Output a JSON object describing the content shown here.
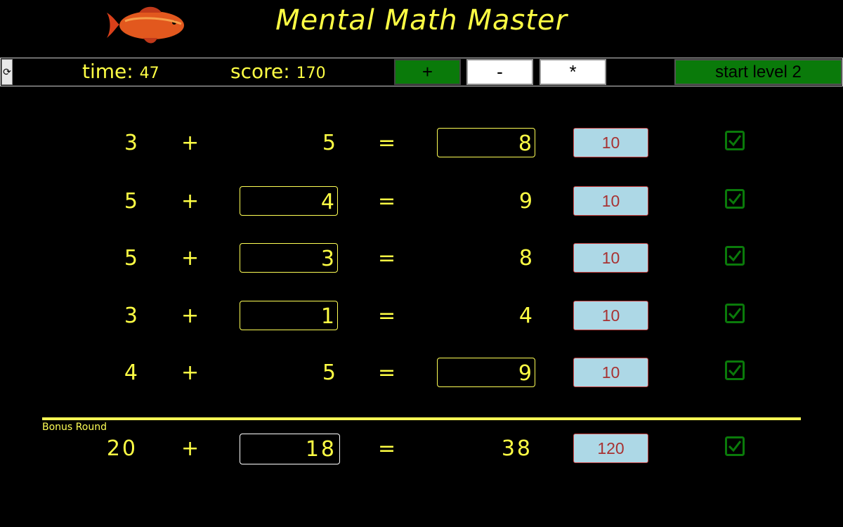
{
  "header": {
    "title": "Mental Math Master"
  },
  "toolbar": {
    "time_label": "time:",
    "time_value": "47",
    "score_label": "score:",
    "score_value": "170",
    "op_plus": "+",
    "op_minus": "-",
    "op_times": "*",
    "start_label": "start level 2"
  },
  "problems": [
    {
      "a": "3",
      "op": "+",
      "b": "5",
      "eq": "=",
      "c": "8",
      "points": "10"
    },
    {
      "a": "5",
      "op": "+",
      "b": "4",
      "eq": "=",
      "c": "9",
      "points": "10"
    },
    {
      "a": "5",
      "op": "+",
      "b": "3",
      "eq": "=",
      "c": "8",
      "points": "10"
    },
    {
      "a": "3",
      "op": "+",
      "b": "1",
      "eq": "=",
      "c": "4",
      "points": "10"
    },
    {
      "a": "4",
      "op": "+",
      "b": "5",
      "eq": "=",
      "c": "9",
      "points": "10"
    }
  ],
  "bonus": {
    "label": "Bonus Round",
    "a": "20",
    "op": "+",
    "b": "18",
    "eq": "=",
    "c": "38",
    "points": "120"
  },
  "colors": {
    "text": "#ffff44",
    "active": "#0a7a0a",
    "points_bg": "#add8e6",
    "points_text": "#a83232",
    "check": "#0a7a0a"
  }
}
